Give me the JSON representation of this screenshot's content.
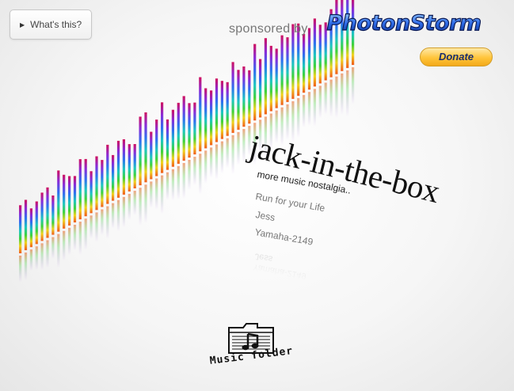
{
  "header": {
    "whats_this_label": "What's this?",
    "sponsored_text": "sponsored by",
    "sponsor_logo_text": "PhotonStorm",
    "donate_label": "Donate"
  },
  "player": {
    "title": "jack-in-the-box",
    "subtitle": "more music nostalgia..",
    "tracks": [
      "Run for your Life",
      "Jess",
      "Yamaha-2149"
    ],
    "folder_label": "Music folder"
  },
  "colors": {
    "logo_blue": "#2d6be8",
    "donate_gold": "#ffc43a",
    "bar_top": "#e0105a"
  }
}
